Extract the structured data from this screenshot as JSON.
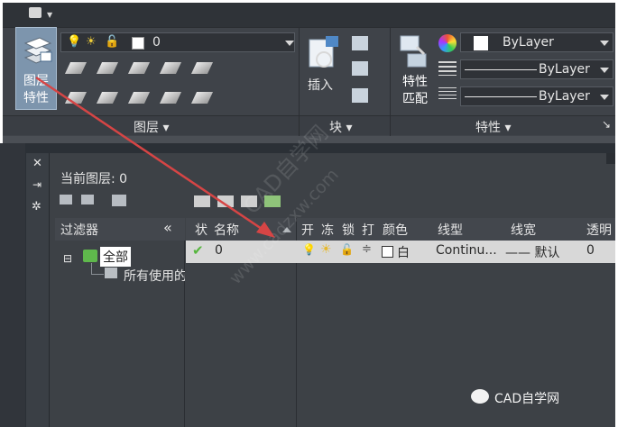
{
  "ribbon": {
    "layer_panel_label": "图层",
    "block_panel_label": "块",
    "properties_panel_label": "特性",
    "big_layer_button_lines": [
      "图层",
      "特性"
    ],
    "insert_label": "插入",
    "match_props_lines": [
      "特性",
      "匹配"
    ],
    "current_layer_value": "0",
    "color_value": "ByLayer",
    "linetype_value": "ByLayer",
    "lineweight_value": "ByLayer"
  },
  "layer_manager": {
    "current_layer_text": "当前图层: 0",
    "filter_header": "过滤器",
    "collapse_symbol": "«",
    "tree": {
      "root_label": "全部",
      "child_label": "所有使用的"
    },
    "columns": [
      "状",
      "名称",
      "开",
      "冻",
      "锁",
      "打",
      "颜色",
      "线型",
      "线宽",
      "透明"
    ],
    "rows": [
      {
        "name": "0",
        "color_name": "白",
        "linetype": "Continu...",
        "lineweight": "—— 默认",
        "transparency": "0"
      }
    ]
  },
  "watermark": {
    "diagonal": "www.cadzxw.com",
    "diagonal_cn": "CAD自学网",
    "footer": "CAD自学网"
  },
  "colors": {
    "arrow": "#d64545",
    "accent_blue": "#7d95ad",
    "check_green": "#56b63d"
  }
}
